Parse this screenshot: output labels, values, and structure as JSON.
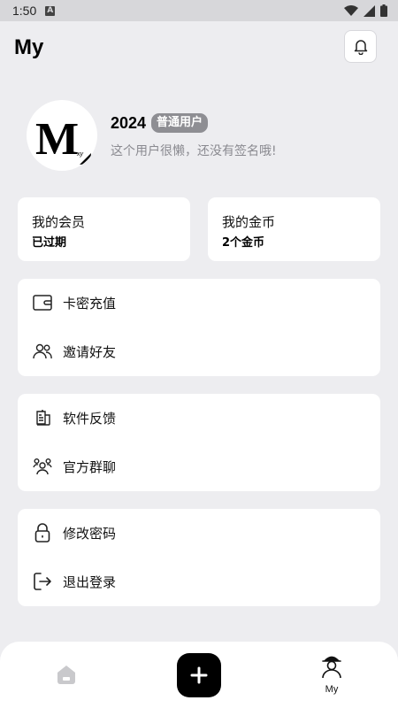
{
  "status_bar": {
    "time": "1:50",
    "notif_icon": "A"
  },
  "header": {
    "title": "My"
  },
  "profile": {
    "name": "2024",
    "badge": "普通用户",
    "bio": "这个用户很懒，还没有签名哦!",
    "avatar_letters": "M",
    "avatar_sub": "xy"
  },
  "stats": [
    {
      "title": "我的会员",
      "value": "已过期"
    },
    {
      "title": "我的金币",
      "value": "2个金币"
    }
  ],
  "menu_groups": [
    {
      "items": [
        {
          "label": "卡密充值",
          "icon": "wallet-icon"
        },
        {
          "label": "邀请好友",
          "icon": "users-icon"
        }
      ]
    },
    {
      "items": [
        {
          "label": "软件反馈",
          "icon": "feedback-icon"
        },
        {
          "label": "官方群聊",
          "icon": "group-icon"
        }
      ]
    },
    {
      "items": [
        {
          "label": "修改密码",
          "icon": "lock-icon"
        },
        {
          "label": "退出登录",
          "icon": "logout-icon"
        }
      ]
    }
  ],
  "bottom_nav": {
    "my_label": "My"
  }
}
